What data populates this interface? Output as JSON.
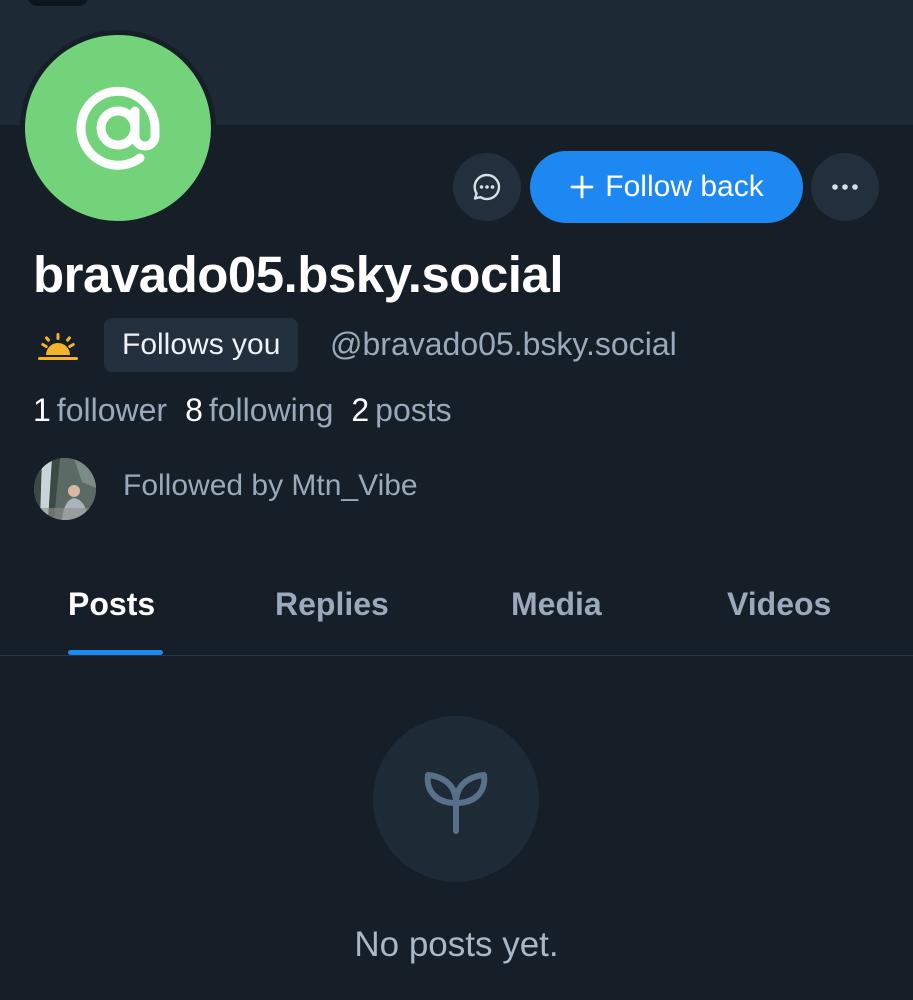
{
  "profile": {
    "display_name": "bravado05.bsky.social",
    "handle": "@bravado05.bsky.social",
    "follows_you_badge": "Follows you",
    "avatar_color": "#72d37a",
    "stats": {
      "followers_count": "1",
      "followers_label": "follower",
      "following_count": "8",
      "following_label": "following",
      "posts_count": "2",
      "posts_label": "posts"
    },
    "followed_by": "Followed by Mtn_Vibe"
  },
  "actions": {
    "follow_back_label": "Follow back",
    "accent_color": "#1d88f2"
  },
  "icons": {
    "avatar": "at-sign-icon",
    "message": "chat-bubble-icon",
    "follow": "plus-icon",
    "more": "ellipsis-icon",
    "pronoun_or_badge": "sunrise-icon",
    "empty_state": "sprout-icon"
  },
  "tabs": [
    {
      "label": "Posts",
      "active": true
    },
    {
      "label": "Replies",
      "active": false
    },
    {
      "label": "Media",
      "active": false
    },
    {
      "label": "Videos",
      "active": false
    }
  ],
  "empty_state": {
    "message": "No posts yet."
  }
}
